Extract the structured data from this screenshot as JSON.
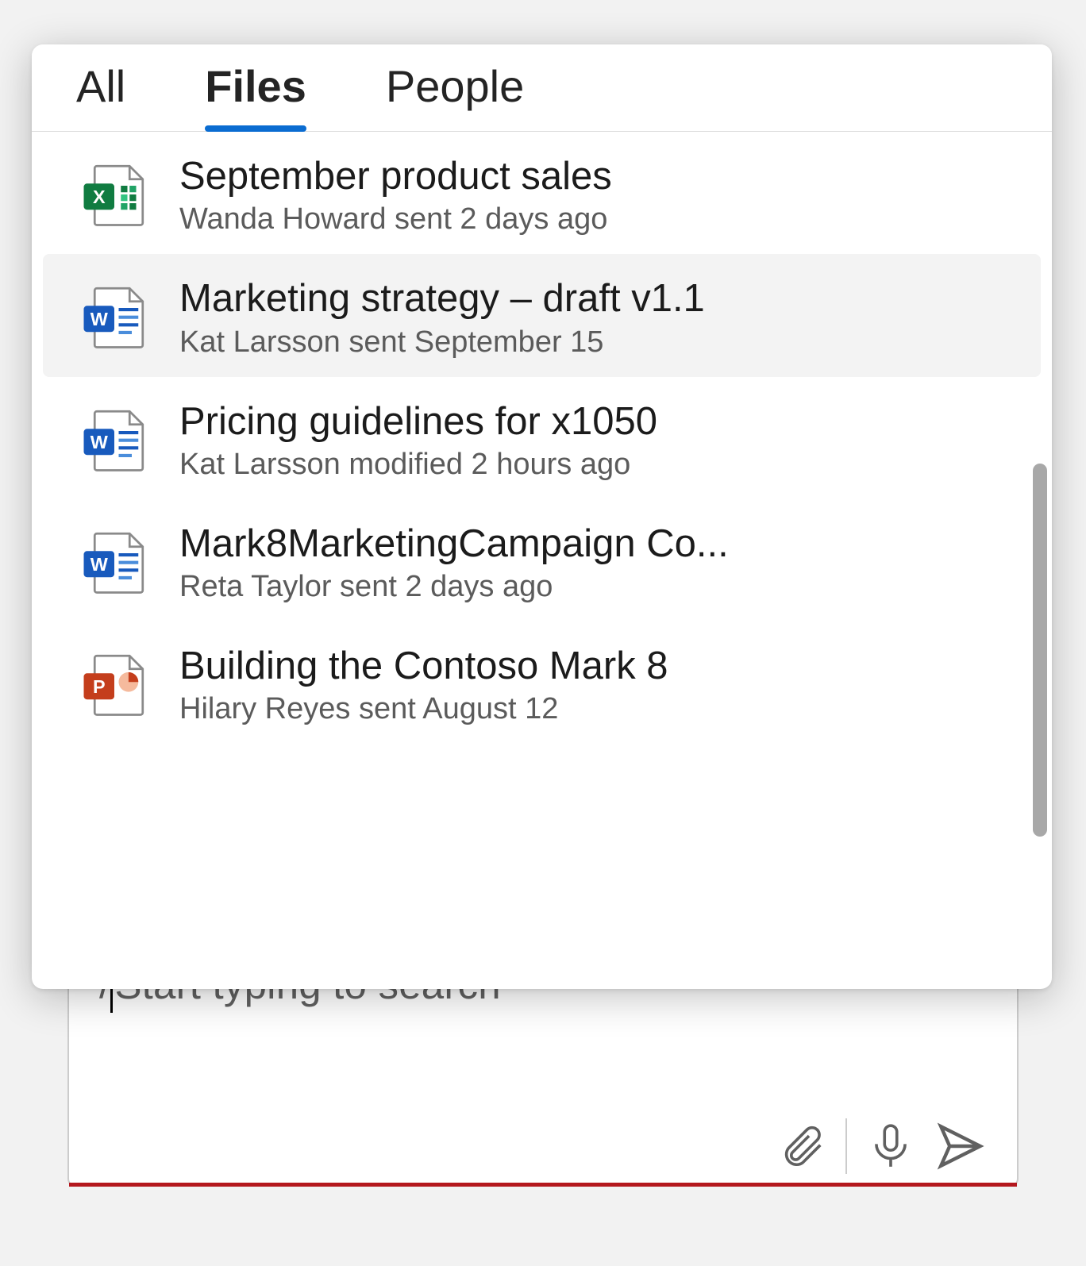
{
  "tabs": [
    {
      "label": "All",
      "active": false
    },
    {
      "label": "Files",
      "active": true
    },
    {
      "label": "People",
      "active": false
    }
  ],
  "results": [
    {
      "type": "excel",
      "title": "September product sales",
      "meta": "Wanda Howard sent 2 days ago",
      "selected": false
    },
    {
      "type": "word",
      "title": "Marketing strategy – draft v1.1",
      "meta": "Kat Larsson sent September 15",
      "selected": true
    },
    {
      "type": "word",
      "title": "Pricing guidelines for x1050",
      "meta": "Kat Larsson modified 2 hours ago",
      "selected": false
    },
    {
      "type": "word",
      "title": "Mark8MarketingCampaign Co...",
      "meta": "Reta Taylor sent 2 days ago",
      "selected": false
    },
    {
      "type": "powerpoint",
      "title": "Building the Contoso Mark 8",
      "meta": "Hilary Reyes sent August 12",
      "selected": false
    }
  ],
  "compose": {
    "slash": "/",
    "placeholder": "Start typing to search"
  },
  "icons": {
    "excel": {
      "bg": "#ffffff",
      "badge": "#107c41",
      "letter": "X"
    },
    "word": {
      "bg": "#ffffff",
      "badge": "#185abd",
      "letter": "W"
    },
    "powerpoint": {
      "bg": "#ffffff",
      "badge": "#c43e1c",
      "letter": "P"
    }
  }
}
